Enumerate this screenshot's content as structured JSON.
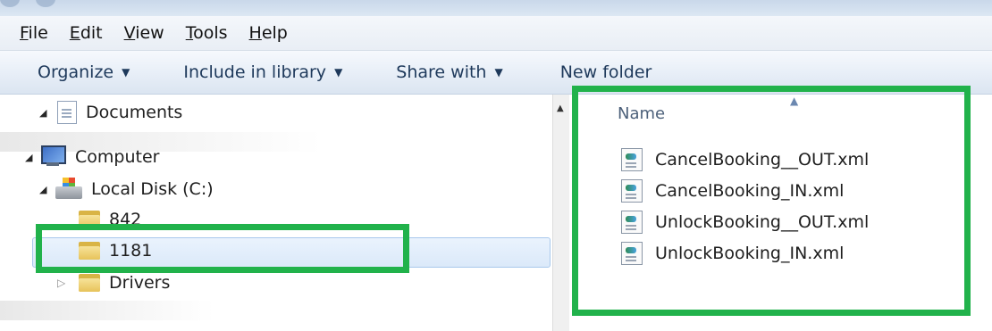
{
  "menubar": {
    "items": [
      {
        "label": "File",
        "access": "F",
        "rest": "ile"
      },
      {
        "label": "Edit",
        "access": "E",
        "rest": "dit"
      },
      {
        "label": "View",
        "access": "V",
        "rest": "iew"
      },
      {
        "label": "Tools",
        "access": "T",
        "rest": "ools"
      },
      {
        "label": "Help",
        "access": "H",
        "rest": "elp"
      }
    ]
  },
  "toolbar": {
    "organize": "Organize",
    "include": "Include in library",
    "share": "Share with",
    "new_folder": "New folder"
  },
  "nav": {
    "documents": "Documents",
    "computer": "Computer",
    "local_disk": "Local Disk (C:)",
    "folder_842": "842",
    "folder_1181": "1181",
    "drivers": "Drivers"
  },
  "content": {
    "column_name": "Name",
    "files": [
      "CancelBooking__OUT.xml",
      "CancelBooking_IN.xml",
      "UnlockBooking__OUT.xml",
      "UnlockBooking_IN.xml"
    ]
  },
  "colors": {
    "highlight": "#21b24b",
    "selection": "#dbe9f9"
  }
}
